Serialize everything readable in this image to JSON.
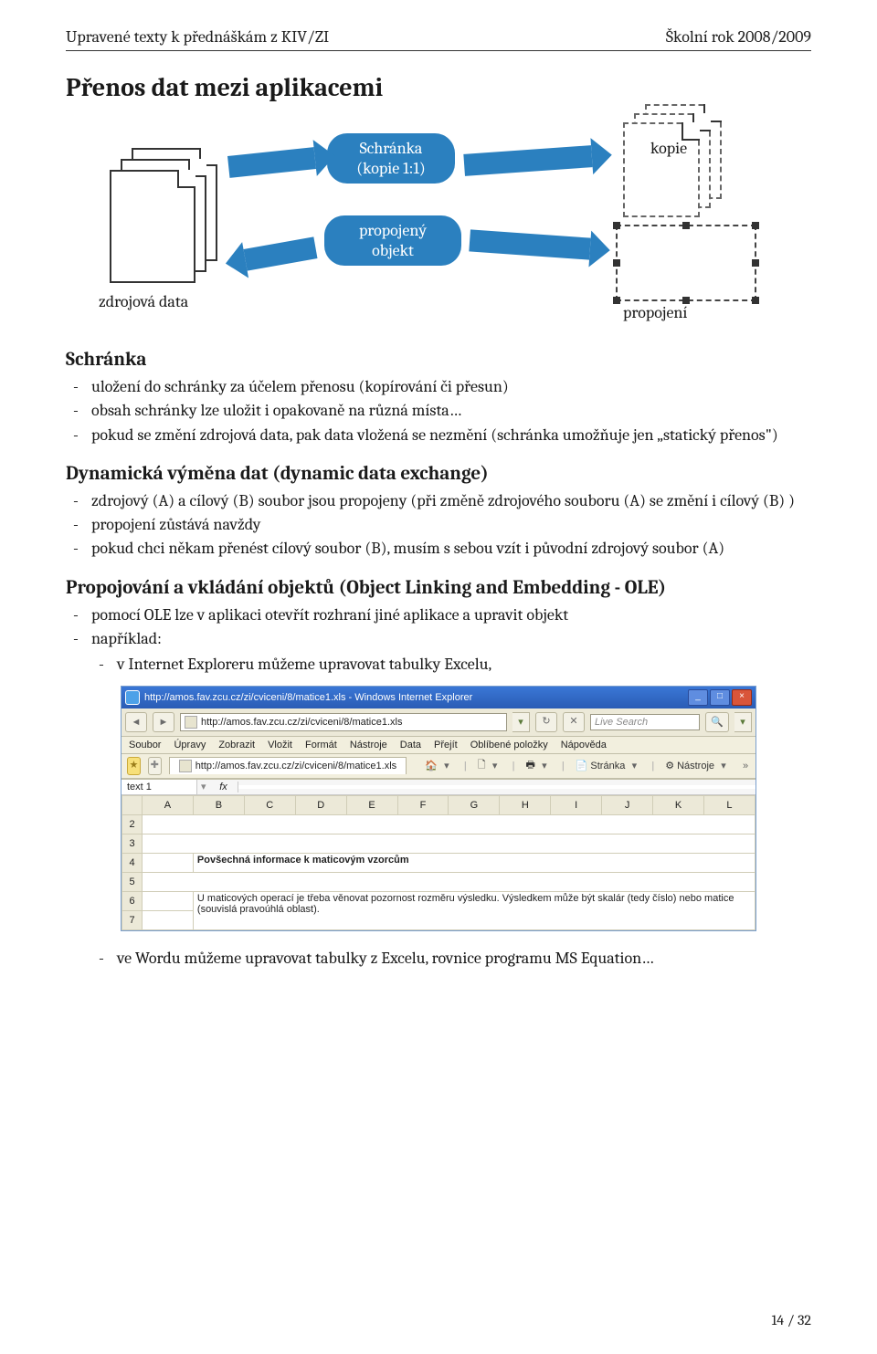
{
  "header": {
    "left": "Upravené texty k přednáškám z KIV/ZI",
    "right_line1": "Školní rok 2008/2009"
  },
  "title": "Přenos dat mezi aplikacemi",
  "diagram": {
    "source_label": "zdrojová data",
    "pill_top": "Schránka\n(kopie 1:1)",
    "pill_bottom": "propojený\nobjekt",
    "copy_label": "kopie",
    "linked_label": "propojení"
  },
  "schranka": {
    "heading": "Schránka",
    "items": [
      "uložení do schránky za účelem přenosu (kopírování či přesun)",
      "obsah schránky lze uložit i opakovaně na různá místa…",
      "pokud se změní zdrojová data, pak data vložená se nezmění (schránka umožňuje jen „statický přenos\")"
    ]
  },
  "dde": {
    "heading": "Dynamická výměna dat (dynamic data exchange)",
    "items": [
      "zdrojový (A) a cílový (B) soubor jsou propojeny (při změně zdrojového souboru (A) se změní i cílový (B) )",
      "propojení zůstává navždy",
      "pokud chci někam přenést cílový soubor (B), musím s sebou vzít i původní zdrojový soubor (A)"
    ]
  },
  "ole": {
    "heading": "Propojování a vkládání objektů (Object Linking and Embedding - OLE)",
    "items": [
      "pomocí OLE lze v aplikaci otevřít rozhraní jiné aplikace a upravit objekt",
      "například:"
    ],
    "sub": "v Internet Exploreru můžeme upravovat tabulky Excelu,"
  },
  "ie": {
    "title": "http://amos.fav.zcu.cz/zi/cviceni/8/matice1.xls - Windows Internet Explorer",
    "url": "http://amos.fav.zcu.cz/zi/cviceni/8/matice1.xls",
    "search_placeholder": "Live Search",
    "menu": [
      "Soubor",
      "Úpravy",
      "Zobrazit",
      "Vložit",
      "Formát",
      "Nástroje",
      "Data",
      "Přejít",
      "Oblíbené položky",
      "Nápověda"
    ],
    "tab": "http://amos.fav.zcu.cz/zi/cviceni/8/matice1.xls",
    "tools": {
      "stranka": "Stránka",
      "nastroje": "Nástroje"
    }
  },
  "excel": {
    "namebox": "text 1",
    "fx": "fx",
    "columns": [
      "A",
      "B",
      "C",
      "D",
      "E",
      "F",
      "G",
      "H",
      "I",
      "J",
      "K",
      "L"
    ],
    "rows": [
      "2",
      "3",
      "4",
      "5",
      "6",
      "7"
    ],
    "title_cell": "Povšechná informace k maticovým vzorcům",
    "body_cell": "U maticových operací je třeba věnovat pozornost rozměru výsledku. Výsledkem může být skalár (tedy číslo) nebo matice (souvislá pravoúhlá oblast)."
  },
  "after_shot": "ve Wordu můžeme upravovat tabulky z Excelu, rovnice programu MS Equation…",
  "footer": "14 / 32"
}
